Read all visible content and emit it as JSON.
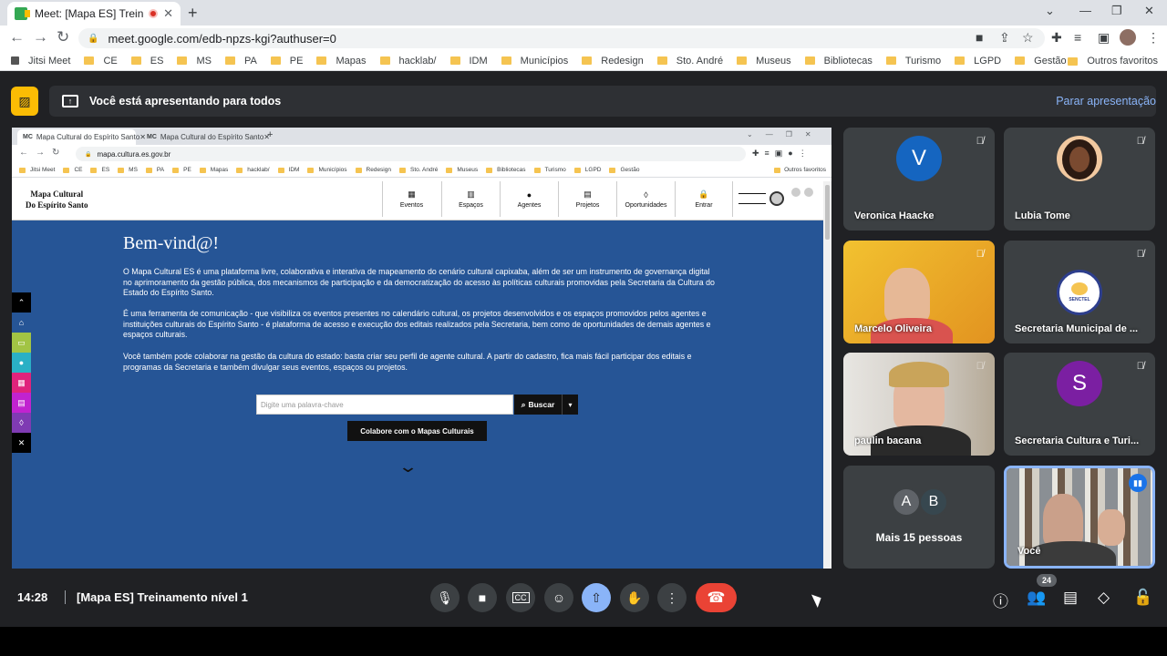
{
  "browser": {
    "tab_title": "Meet: [Mapa ES] Treinament",
    "url": "meet.google.com/edb-npzs-kgi?authuser=0",
    "bookmarks": [
      "Jitsi Meet",
      "CE",
      "ES",
      "MS",
      "PA",
      "PE",
      "Mapas",
      "hacklab/",
      "IDM",
      "Municípios",
      "Redesign",
      "Sto. André",
      "Museus",
      "Bibliotecas",
      "Turismo",
      "LGPD",
      "Gestão"
    ],
    "other_favorites": "Outros favoritos"
  },
  "meet": {
    "presenting_text": "Você está apresentando para todos",
    "stop_presenting": "Parar apresentação",
    "time": "14:28",
    "meeting_name": "[Mapa ES] Treinamento nível 1",
    "participant_count": "24",
    "participants": [
      {
        "name": "Veronica Haacke",
        "initial": "V",
        "color": "#1565c0"
      },
      {
        "name": "Lubia Tome"
      },
      {
        "name": "Marcelo Oliveira"
      },
      {
        "name": "Secretaria Municipal de ..."
      },
      {
        "name": "paulin bacana"
      },
      {
        "name": "Secretaria Cultura e Turi...",
        "initial": "S",
        "color": "#7b1fa2"
      }
    ],
    "more": {
      "avatars": [
        "A",
        "B"
      ],
      "label": "Mais 15 pessoas"
    },
    "self_label": "Você",
    "secretaria_badge": "SENCTEL"
  },
  "shared": {
    "tabs": [
      "Mapa Cultural do Espírito Santo",
      "Mapa Cultural do Espírito Santo"
    ],
    "url": "mapa.cultura.es.gov.br",
    "site_title": "Mapa Cultural\nDo Espírito Santo",
    "nav": [
      "Eventos",
      "Espaços",
      "Agentes",
      "Projetos",
      "Oportunidades",
      "Entrar"
    ],
    "welcome": "Bem-vind@!",
    "para1": "O Mapa Cultural ES é uma plataforma livre, colaborativa e interativa de mapeamento do cenário cultural capixaba, além de ser um instrumento de governança digital no aprimoramento da gestão pública, dos mecanismos de participação e da democratização do acesso às políticas culturais promovidas pela Secretaria da Cultura do Estado do Espírito Santo.",
    "para2": "É uma ferramenta de comunicação - que visibiliza os eventos presentes no calendário cultural, os projetos desenvolvidos e os espaços promovidos pelos agentes e instituições culturais do Espírito Santo - é plataforma de acesso e execução dos editais realizados pela Secretaria, bem como de oportunidades de demais agentes e espaços culturais.",
    "para3": "Você também pode colaborar na gestão da cultura do estado: basta criar seu perfil de agente cultural. A partir do cadastro, fica mais fácil participar dos editais e programas da Secretaria e também divulgar seus eventos, espaços ou projetos.",
    "search_placeholder": "Digite uma palavra-chave",
    "search_button": "Buscar",
    "collab_button": "Colabore com o Mapas Culturais",
    "sidebar_colors": [
      "#000000",
      "#265596",
      "#a2c444",
      "#2ab0c5",
      "#e0237c",
      "#c123d0",
      "#7f3bb3",
      "#000000"
    ]
  }
}
